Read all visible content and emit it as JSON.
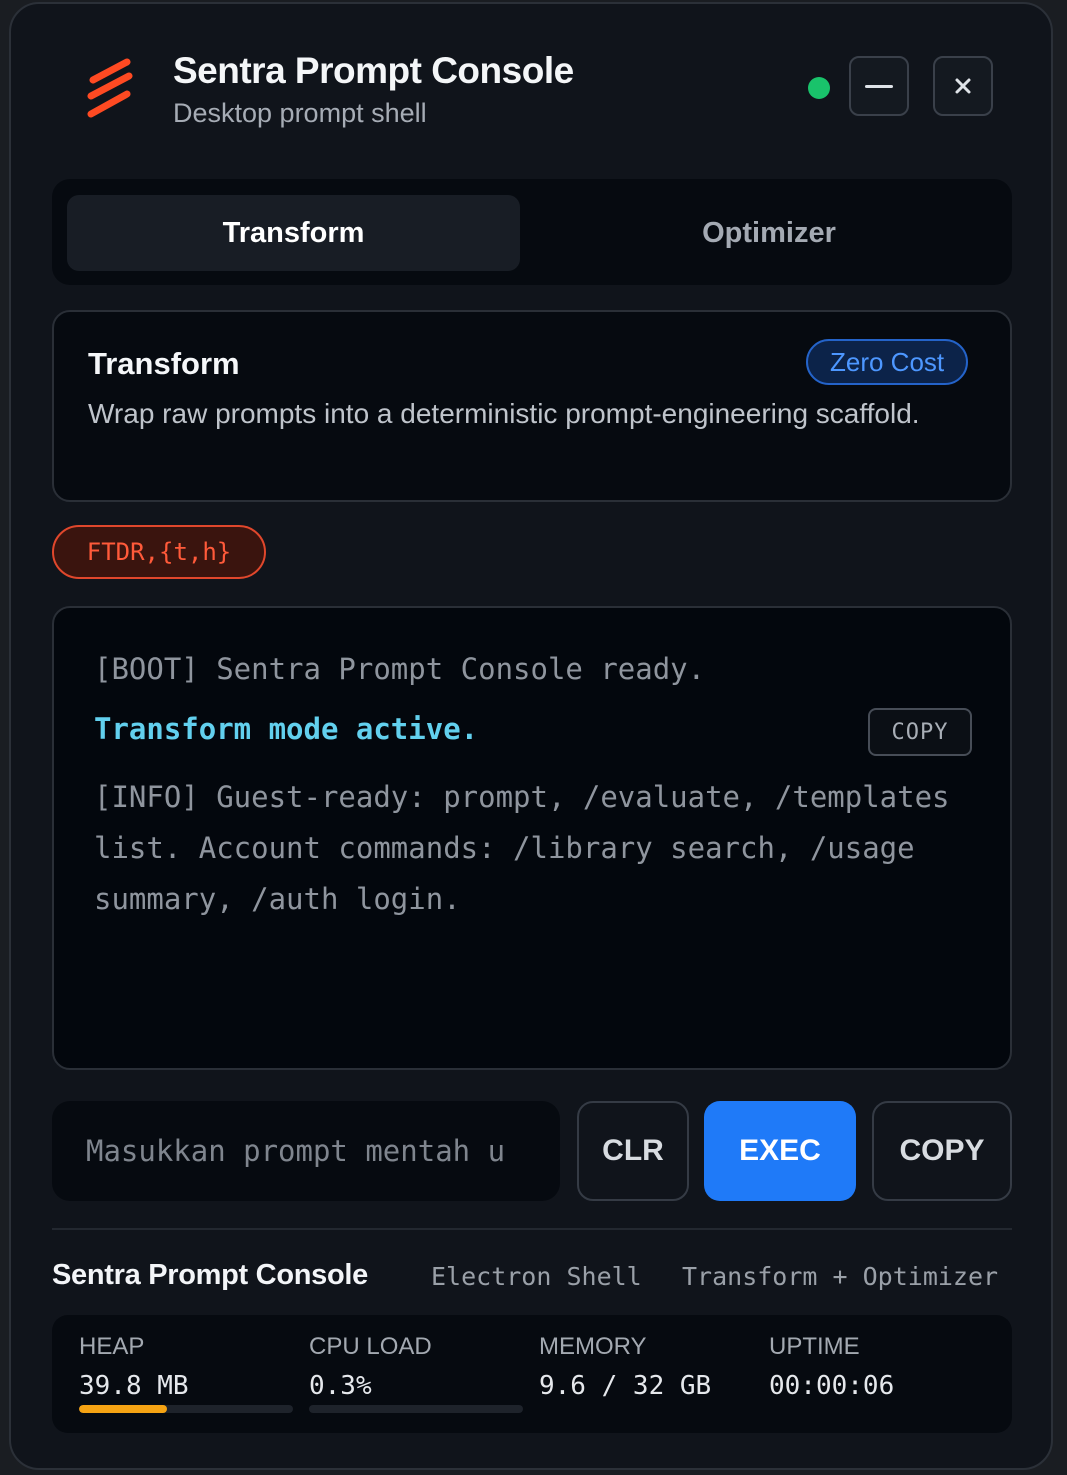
{
  "app": {
    "title": "Sentra Prompt Console",
    "subtitle": "Desktop prompt shell",
    "logo_icon": "sentra-logo-icon",
    "status_color": "#19c36b"
  },
  "window_controls": {
    "minimize_icon": "minimize-icon",
    "close_icon": "close-icon",
    "close_glyph": "✕"
  },
  "tabs": [
    {
      "label": "Transform",
      "active": true
    },
    {
      "label": "Optimizer",
      "active": false
    }
  ],
  "mode_card": {
    "title": "Transform",
    "badge": "Zero Cost",
    "description": "Wrap raw prompts into a deterministic prompt-engineering scaffold."
  },
  "tag_chip": "FTDR,{t,h}",
  "terminal": {
    "lines": [
      "[BOOT] Sentra Prompt Console ready.",
      "Transform mode active.",
      "[INFO] Guest-ready: prompt, /evaluate, /templates list. Account commands: /library search, /usage summary, /auth login."
    ],
    "copy_label": "COPY"
  },
  "input": {
    "placeholder": "Masukkan prompt mentah u",
    "value": ""
  },
  "actions": {
    "clear": "CLR",
    "execute": "EXEC",
    "copy": "COPY"
  },
  "footer": {
    "title": "Sentra Prompt Console",
    "shell": "Electron Shell",
    "modes": "Transform + Optimizer"
  },
  "stats": [
    {
      "label": "HEAP",
      "value": "39.8 MB",
      "bar_fraction": 0.41,
      "bar_color": "#f5a313"
    },
    {
      "label": "CPU LOAD",
      "value": "0.3%",
      "bar_fraction": 0.0
    },
    {
      "label": "MEMORY",
      "value": "9.6 / 32 GB"
    },
    {
      "label": "UPTIME",
      "value": "00:00:06"
    }
  ],
  "colors": {
    "accent": "#1f7af8",
    "active_line": "#62d0ee",
    "tag": "#ff5a3a",
    "badge": "#4d97ff"
  }
}
